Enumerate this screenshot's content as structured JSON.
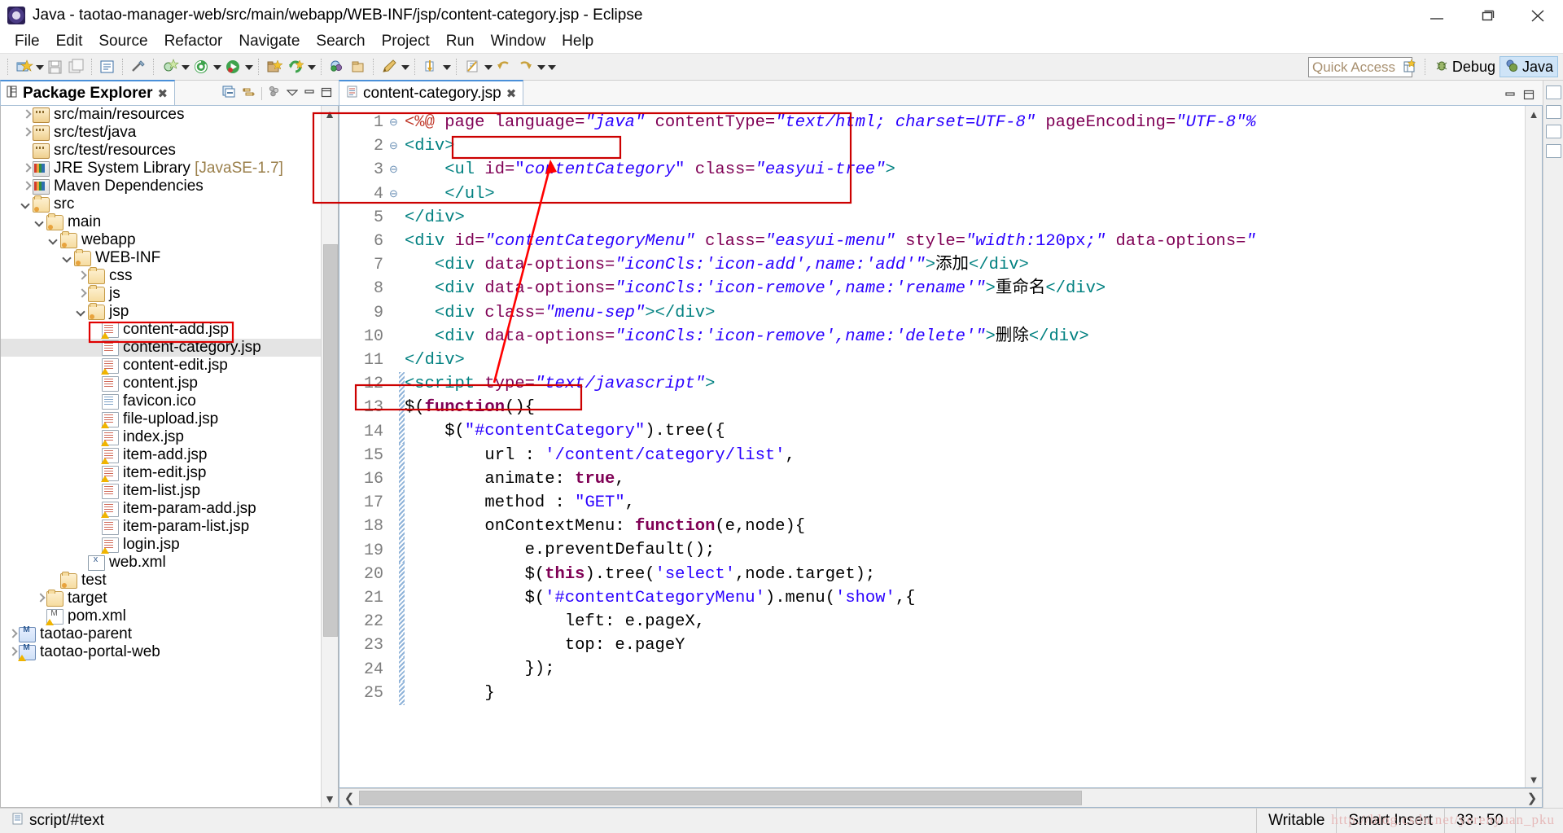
{
  "window": {
    "title": "Java - taotao-manager-web/src/main/webapp/WEB-INF/jsp/content-category.jsp - Eclipse",
    "app_icon": "eclipse-icon",
    "minimize": "—",
    "maximize": "❐",
    "close": "✕"
  },
  "menubar": {
    "items": [
      "File",
      "Edit",
      "Source",
      "Refactor",
      "Navigate",
      "Search",
      "Project",
      "Run",
      "Window",
      "Help"
    ]
  },
  "toolbar": {
    "quick_access_placeholder": "Quick Access",
    "quick_access_value": "",
    "open_perspective_label": "",
    "perspectives": [
      {
        "label": "Debug",
        "icon": "debug-bug-icon",
        "active": false
      },
      {
        "label": "Java",
        "icon": "java-perspective-icon",
        "active": true
      }
    ]
  },
  "package_explorer": {
    "tab_label": "Package Explorer",
    "close_glyph": "✖",
    "view_icons": [
      "collapse-all-icon",
      "link-with-editor-icon",
      "view-menu-icon",
      "minimize-view-icon",
      "maximize-view-icon"
    ],
    "tree": [
      {
        "label": "src/main/resources",
        "indent": 1,
        "arrow": "right",
        "icon": "package-folder-icon"
      },
      {
        "label": "src/test/java",
        "indent": 1,
        "arrow": "right",
        "icon": "package-folder-icon"
      },
      {
        "label": "src/test/resources",
        "indent": 1,
        "arrow": "none",
        "icon": "package-folder-icon"
      },
      {
        "label": "JRE System Library",
        "suffix": " [JavaSE-1.7]",
        "indent": 1,
        "arrow": "right",
        "icon": "library-icon"
      },
      {
        "label": "Maven Dependencies",
        "indent": 1,
        "arrow": "right",
        "icon": "library-icon"
      },
      {
        "label": "src",
        "indent": 1,
        "arrow": "down",
        "icon": "source-folder-icon"
      },
      {
        "label": "main",
        "indent": 2,
        "arrow": "down",
        "icon": "source-folder-icon"
      },
      {
        "label": "webapp",
        "indent": 3,
        "arrow": "down",
        "icon": "source-folder-icon"
      },
      {
        "label": "WEB-INF",
        "indent": 4,
        "arrow": "down",
        "icon": "source-folder-icon"
      },
      {
        "label": "css",
        "indent": 5,
        "arrow": "right",
        "icon": "folder-icon"
      },
      {
        "label": "js",
        "indent": 5,
        "arrow": "right",
        "icon": "folder-icon"
      },
      {
        "label": "jsp",
        "indent": 5,
        "arrow": "down",
        "icon": "source-folder-icon"
      },
      {
        "label": "content-add.jsp",
        "indent": 6,
        "arrow": "none",
        "icon": "jsp-file-warning-icon"
      },
      {
        "label": "content-category.jsp",
        "indent": 6,
        "arrow": "none",
        "icon": "jsp-file-icon",
        "selected": true,
        "highlight": true
      },
      {
        "label": "content-edit.jsp",
        "indent": 6,
        "arrow": "none",
        "icon": "jsp-file-warning-icon"
      },
      {
        "label": "content.jsp",
        "indent": 6,
        "arrow": "none",
        "icon": "jsp-file-icon"
      },
      {
        "label": "favicon.ico",
        "indent": 6,
        "arrow": "none",
        "icon": "file-icon"
      },
      {
        "label": "file-upload.jsp",
        "indent": 6,
        "arrow": "none",
        "icon": "jsp-file-warning-icon"
      },
      {
        "label": "index.jsp",
        "indent": 6,
        "arrow": "none",
        "icon": "jsp-file-warning-icon"
      },
      {
        "label": "item-add.jsp",
        "indent": 6,
        "arrow": "none",
        "icon": "jsp-file-warning-icon"
      },
      {
        "label": "item-edit.jsp",
        "indent": 6,
        "arrow": "none",
        "icon": "jsp-file-warning-icon"
      },
      {
        "label": "item-list.jsp",
        "indent": 6,
        "arrow": "none",
        "icon": "jsp-file-icon"
      },
      {
        "label": "item-param-add.jsp",
        "indent": 6,
        "arrow": "none",
        "icon": "jsp-file-warning-icon"
      },
      {
        "label": "item-param-list.jsp",
        "indent": 6,
        "arrow": "none",
        "icon": "jsp-file-icon"
      },
      {
        "label": "login.jsp",
        "indent": 6,
        "arrow": "none",
        "icon": "jsp-file-warning-icon"
      },
      {
        "label": "web.xml",
        "indent": 5,
        "arrow": "none",
        "icon": "xml-file-icon"
      },
      {
        "label": "test",
        "indent": 3,
        "arrow": "none",
        "icon": "source-folder-icon"
      },
      {
        "label": "target",
        "indent": 2,
        "arrow": "right",
        "icon": "folder-icon"
      },
      {
        "label": "pom.xml",
        "indent": 2,
        "arrow": "none",
        "icon": "pom-file-icon"
      },
      {
        "label": "taotao-parent",
        "indent": 0,
        "arrow": "right",
        "icon": "maven-project-icon"
      },
      {
        "label": "taotao-portal-web",
        "indent": 0,
        "arrow": "right",
        "icon": "maven-project-warning-icon"
      }
    ]
  },
  "editor": {
    "tab_label": "content-category.jsp",
    "close_glyph": "✖",
    "file_icon": "jsp-file-icon",
    "lines": [
      {
        "no": 1,
        "fold": "",
        "change": false,
        "tokens": [
          {
            "t": "<%@ ",
            "c": "k-jsp"
          },
          {
            "t": "page ",
            "c": "k-attr"
          },
          {
            "t": "language=",
            "c": "k-attr"
          },
          {
            "t": "\"java\"",
            "c": "k-stri"
          },
          {
            "t": " contentType=",
            "c": "k-attr"
          },
          {
            "t": "\"text/html; charset=UTF-8\"",
            "c": "k-stri"
          },
          {
            "t": " pageEncoding=",
            "c": "k-attr"
          },
          {
            "t": "\"UTF-8\"%",
            "c": "k-stri"
          }
        ]
      },
      {
        "no": 2,
        "fold": "⊖",
        "change": false,
        "tokens": [
          {
            "t": "<div>",
            "c": "k-tag"
          }
        ]
      },
      {
        "no": 3,
        "fold": "⊖",
        "change": false,
        "tokens": [
          {
            "t": "    <ul ",
            "c": "k-tag"
          },
          {
            "t": "id=",
            "c": "k-attr"
          },
          {
            "t": "\"",
            "c": "k-str"
          },
          {
            "t": "contentCategory",
            "c": "k-stri"
          },
          {
            "t": "\"",
            "c": "k-str"
          },
          {
            "t": " class=",
            "c": "k-attr"
          },
          {
            "t": "\"easyui-tree\"",
            "c": "k-stri"
          },
          {
            "t": ">",
            "c": "k-tag"
          }
        ]
      },
      {
        "no": 4,
        "fold": "",
        "change": false,
        "tokens": [
          {
            "t": "    </ul>",
            "c": "k-tag"
          }
        ]
      },
      {
        "no": 5,
        "fold": "",
        "change": false,
        "tokens": [
          {
            "t": "</div>",
            "c": "k-tag"
          }
        ]
      },
      {
        "no": 6,
        "fold": "⊖",
        "change": false,
        "tokens": [
          {
            "t": "<div ",
            "c": "k-tag"
          },
          {
            "t": "id=",
            "c": "k-attr"
          },
          {
            "t": "\"contentCategoryMenu\"",
            "c": "k-stri"
          },
          {
            "t": " class=",
            "c": "k-attr"
          },
          {
            "t": "\"easyui-menu\"",
            "c": "k-stri"
          },
          {
            "t": " style=",
            "c": "k-attr"
          },
          {
            "t": "\"width:",
            "c": "k-stri"
          },
          {
            "t": "120px",
            "c": "k-num"
          },
          {
            "t": ";\"",
            "c": "k-stri"
          },
          {
            "t": " data-options=",
            "c": "k-attr"
          },
          {
            "t": "\"",
            "c": "k-stri"
          }
        ]
      },
      {
        "no": 7,
        "fold": "",
        "change": false,
        "tokens": [
          {
            "t": "   <div ",
            "c": "k-tag"
          },
          {
            "t": "data-options=",
            "c": "k-attr"
          },
          {
            "t": "\"iconCls:'icon-add',name:'add'\"",
            "c": "k-stri"
          },
          {
            "t": ">",
            "c": "k-tag"
          },
          {
            "t": "添加",
            "c": "k-txt"
          },
          {
            "t": "</div>",
            "c": "k-tag"
          }
        ]
      },
      {
        "no": 8,
        "fold": "",
        "change": false,
        "tokens": [
          {
            "t": "   <div ",
            "c": "k-tag"
          },
          {
            "t": "data-options=",
            "c": "k-attr"
          },
          {
            "t": "\"iconCls:'icon-remove',name:'rename'\"",
            "c": "k-stri"
          },
          {
            "t": ">",
            "c": "k-tag"
          },
          {
            "t": "重命名",
            "c": "k-txt"
          },
          {
            "t": "</div>",
            "c": "k-tag"
          }
        ]
      },
      {
        "no": 9,
        "fold": "",
        "change": false,
        "tokens": [
          {
            "t": "   <div ",
            "c": "k-tag"
          },
          {
            "t": "class=",
            "c": "k-attr"
          },
          {
            "t": "\"menu-sep\"",
            "c": "k-stri"
          },
          {
            "t": "></div>",
            "c": "k-tag"
          }
        ]
      },
      {
        "no": 10,
        "fold": "",
        "change": false,
        "tokens": [
          {
            "t": "   <div ",
            "c": "k-tag"
          },
          {
            "t": "data-options=",
            "c": "k-attr"
          },
          {
            "t": "\"iconCls:'icon-remove',name:'delete'\"",
            "c": "k-stri"
          },
          {
            "t": ">",
            "c": "k-tag"
          },
          {
            "t": "删除",
            "c": "k-txt"
          },
          {
            "t": "</div>",
            "c": "k-tag"
          }
        ]
      },
      {
        "no": 11,
        "fold": "",
        "change": false,
        "tokens": [
          {
            "t": "</div>",
            "c": "k-tag"
          }
        ]
      },
      {
        "no": 12,
        "fold": "⊖",
        "change": true,
        "tokens": [
          {
            "t": "<script ",
            "c": "k-tag"
          },
          {
            "t": "type=",
            "c": "k-attr"
          },
          {
            "t": "\"text/javascript\"",
            "c": "k-stri"
          },
          {
            "t": ">",
            "c": "k-tag"
          }
        ]
      },
      {
        "no": 13,
        "fold": "",
        "change": true,
        "tokens": [
          {
            "t": "$(",
            "c": "k-plain"
          },
          {
            "t": "function",
            "c": "k-kw"
          },
          {
            "t": "(){",
            "c": "k-plain"
          }
        ]
      },
      {
        "no": 14,
        "fold": "",
        "change": true,
        "tokens": [
          {
            "t": "    $(",
            "c": "k-plain"
          },
          {
            "t": "\"#contentCategory\"",
            "c": "k-str"
          },
          {
            "t": ").tree({",
            "c": "k-plain"
          }
        ]
      },
      {
        "no": 15,
        "fold": "",
        "change": true,
        "tokens": [
          {
            "t": "        url : ",
            "c": "k-plain"
          },
          {
            "t": "'/content/category/list'",
            "c": "k-str"
          },
          {
            "t": ",",
            "c": "k-plain"
          }
        ]
      },
      {
        "no": 16,
        "fold": "",
        "change": true,
        "tokens": [
          {
            "t": "        animate: ",
            "c": "k-plain"
          },
          {
            "t": "true",
            "c": "k-kw"
          },
          {
            "t": ",",
            "c": "k-plain"
          }
        ]
      },
      {
        "no": 17,
        "fold": "",
        "change": true,
        "tokens": [
          {
            "t": "        method : ",
            "c": "k-plain"
          },
          {
            "t": "\"GET\"",
            "c": "k-str"
          },
          {
            "t": ",",
            "c": "k-plain"
          }
        ]
      },
      {
        "no": 18,
        "fold": "",
        "change": true,
        "tokens": [
          {
            "t": "        onContextMenu: ",
            "c": "k-plain"
          },
          {
            "t": "function",
            "c": "k-kw"
          },
          {
            "t": "(e,node){",
            "c": "k-plain"
          }
        ]
      },
      {
        "no": 19,
        "fold": "",
        "change": true,
        "tokens": [
          {
            "t": "            e.preventDefault();",
            "c": "k-plain"
          }
        ]
      },
      {
        "no": 20,
        "fold": "",
        "change": true,
        "tokens": [
          {
            "t": "            $(",
            "c": "k-plain"
          },
          {
            "t": "this",
            "c": "k-kw"
          },
          {
            "t": ").tree(",
            "c": "k-plain"
          },
          {
            "t": "'select'",
            "c": "k-str"
          },
          {
            "t": ",node.target);",
            "c": "k-plain"
          }
        ]
      },
      {
        "no": 21,
        "fold": "",
        "change": true,
        "tokens": [
          {
            "t": "            $(",
            "c": "k-plain"
          },
          {
            "t": "'#contentCategoryMenu'",
            "c": "k-str"
          },
          {
            "t": ").menu(",
            "c": "k-plain"
          },
          {
            "t": "'show'",
            "c": "k-str"
          },
          {
            "t": ",{",
            "c": "k-plain"
          }
        ]
      },
      {
        "no": 22,
        "fold": "",
        "change": true,
        "tokens": [
          {
            "t": "                left: e.pageX,",
            "c": "k-plain"
          }
        ]
      },
      {
        "no": 23,
        "fold": "",
        "change": true,
        "tokens": [
          {
            "t": "                top: e.pageY",
            "c": "k-plain"
          }
        ]
      },
      {
        "no": 24,
        "fold": "",
        "change": true,
        "tokens": [
          {
            "t": "            });",
            "c": "k-plain"
          }
        ]
      },
      {
        "no": 25,
        "fold": "",
        "change": true,
        "tokens": [
          {
            "t": "        }",
            "c": "k-plain"
          }
        ]
      }
    ]
  },
  "annotations": {
    "box_top_label": "",
    "box_id_label": "",
    "box_selector_label": "",
    "arrow_color": "#ff0000",
    "box_color": "#cc0000"
  },
  "statusbar": {
    "left_icon": "file-icon",
    "left_text": "script/#text",
    "writable": "Writable",
    "insert_mode": "Smart Insert",
    "cursor_position": "33 : 50",
    "watermark": "http://blog.csdn.net/yerenyuan_pku"
  }
}
